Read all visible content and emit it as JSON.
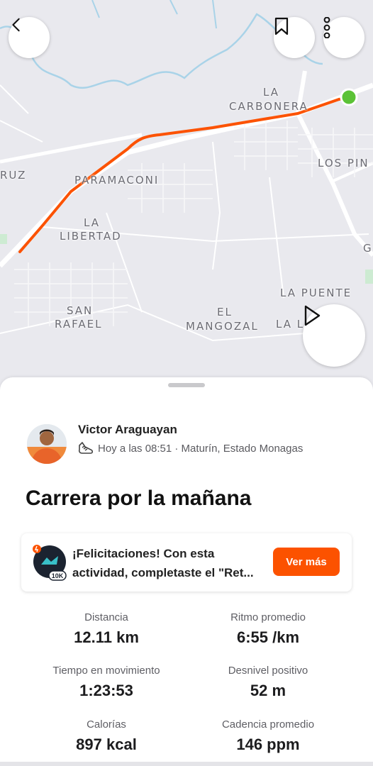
{
  "map": {
    "labels": [
      {
        "id": "la",
        "text": "LA"
      },
      {
        "id": "carbonera",
        "text": "CARBONERA"
      },
      {
        "id": "los_pin",
        "text": "LOS PIN"
      },
      {
        "id": "ruz",
        "text": "RUZ"
      },
      {
        "id": "paramaconi",
        "text": "PARAMACONI"
      },
      {
        "id": "la2",
        "text": "LA"
      },
      {
        "id": "libertad",
        "text": "LIBERTAD"
      },
      {
        "id": "g",
        "text": "G"
      },
      {
        "id": "la_puente",
        "text": "LA PUENTE"
      },
      {
        "id": "san",
        "text": "SAN"
      },
      {
        "id": "rafael",
        "text": "RAFAEL"
      },
      {
        "id": "el",
        "text": "EL"
      },
      {
        "id": "mangozal",
        "text": "MANGOZAL"
      },
      {
        "id": "la_l",
        "text": "LA L"
      }
    ],
    "route_color": "#fc5200",
    "start_marker_color": "#5bc236"
  },
  "activity": {
    "athlete_name": "Victor Araguayan",
    "meta": "Hoy a las 08:51 · Maturín, Estado Monagas",
    "title": "Carrera por la mañana"
  },
  "promo": {
    "line1": "¡Felicitaciones! Con esta",
    "line2": "actividad, completaste el \"Ret...",
    "badge_text": "10K",
    "button": "Ver más"
  },
  "stats": [
    {
      "label": "Distancia",
      "value": "12.11 km"
    },
    {
      "label": "Ritmo promedio",
      "value": "6:55 /km"
    },
    {
      "label": "Tiempo en movimiento",
      "value": "1:23:53"
    },
    {
      "label": "Desnivel positivo",
      "value": "52 m"
    },
    {
      "label": "Calorías",
      "value": "897 kcal"
    },
    {
      "label": "Cadencia promedio",
      "value": "146 ppm"
    }
  ],
  "icons": {
    "back": "chevron-left-icon",
    "bookmark": "bookmark-icon",
    "more": "more-vertical-icon",
    "play": "play-icon",
    "shoe": "shoe-icon"
  },
  "colors": {
    "accent": "#fc5200"
  }
}
